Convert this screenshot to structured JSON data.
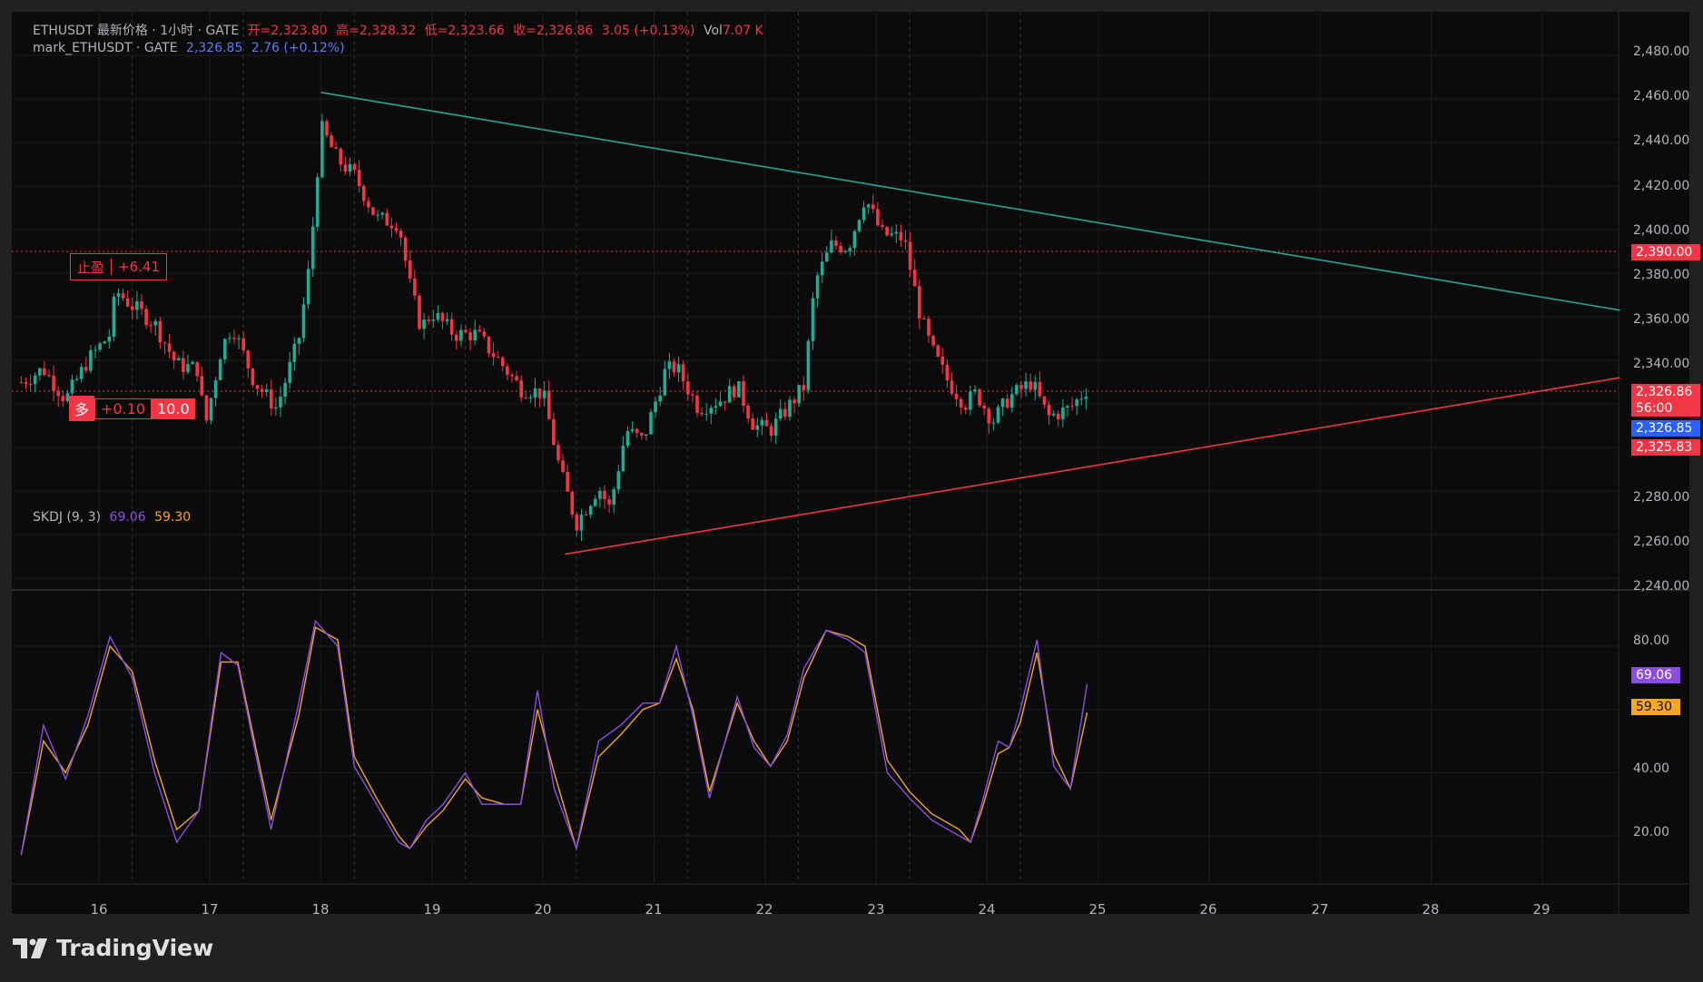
{
  "legend": {
    "symbol_line": [
      "ETHUSDT 最新价格 · 1小时 · GATE",
      "开=2,323.80",
      "高=2,328.32",
      "低=2,323.66",
      "收=2,326.86",
      "3.05 (+0.13%)",
      "Vol",
      "7.07 K"
    ],
    "mark_name": "mark_ETHUSDT · GATE",
    "mark_price": "2,326.85",
    "mark_change": "2.76 (+0.12%)"
  },
  "indicator": {
    "name": "SKDJ (9, 3)",
    "k": "69.06",
    "d": "59.30"
  },
  "price_axis": [
    "2,480.00",
    "2,460.00",
    "2,440.00",
    "2,420.00",
    "2,400.00",
    "2,380.00",
    "2,360.00",
    "2,340.00",
    "2,280.00",
    "2,260.00",
    "2,240.00"
  ],
  "indicator_axis": [
    "80.00",
    "40.00",
    "20.00"
  ],
  "price_tags": {
    "tp": "2,390.00",
    "last": "2,326.86",
    "countdown": "56:00",
    "mark": "2,326.85",
    "entry": "2,325.83",
    "k_tag": "69.06",
    "d_tag": "59.30"
  },
  "take_profit": {
    "label": "止盈",
    "value": "+6.41"
  },
  "position": {
    "side": "多",
    "pnl": "+0.10",
    "qty": "10.0"
  },
  "dates": [
    "16",
    "17",
    "18",
    "19",
    "20",
    "21",
    "22",
    "23",
    "24",
    "25",
    "26",
    "27",
    "28",
    "29"
  ],
  "brand": "TradingView",
  "colors": {
    "up": "#22ab94",
    "down": "#f23645",
    "k_line": "#8a4fe0",
    "d_line": "#f5a623",
    "trend_upper": "#26a69a",
    "trend_lower": "#f23645"
  },
  "chart_data": {
    "type": "candlestick",
    "symbol": "ETHUSDT",
    "interval": "1小时",
    "ylim": [
      2240,
      2490
    ],
    "x_dates": [
      "16",
      "17",
      "18",
      "19",
      "20",
      "21",
      "22",
      "23",
      "24",
      "25",
      "26",
      "27",
      "28",
      "29"
    ],
    "close_path": [
      [
        "15.3",
        2330
      ],
      [
        "15.5",
        2336
      ],
      [
        "15.7",
        2322
      ],
      [
        "15.9",
        2340
      ],
      [
        "16.1",
        2352
      ],
      [
        "16.15",
        2372
      ],
      [
        "16.3",
        2365
      ],
      [
        "16.5",
        2357
      ],
      [
        "16.7",
        2338
      ],
      [
        "16.9",
        2336
      ],
      [
        "16.95",
        2308
      ],
      [
        "17.1",
        2345
      ],
      [
        "17.2",
        2356
      ],
      [
        "17.4",
        2330
      ],
      [
        "17.6",
        2318
      ],
      [
        "17.8",
        2350
      ],
      [
        "17.9",
        2385
      ],
      [
        "18.0",
        2447
      ],
      [
        "18.15",
        2432
      ],
      [
        "18.3",
        2425
      ],
      [
        "18.5",
        2405
      ],
      [
        "18.7",
        2403
      ],
      [
        "18.8",
        2375
      ],
      [
        "18.9",
        2355
      ],
      [
        "19.0",
        2362
      ],
      [
        "19.2",
        2352
      ],
      [
        "19.4",
        2352
      ],
      [
        "19.6",
        2340
      ],
      [
        "19.8",
        2327
      ],
      [
        "20.0",
        2325
      ],
      [
        "20.15",
        2290
      ],
      [
        "20.3",
        2265
      ],
      [
        "20.5",
        2282
      ],
      [
        "20.6",
        2272
      ],
      [
        "20.75",
        2308
      ],
      [
        "20.9",
        2303
      ],
      [
        "21.1",
        2335
      ],
      [
        "21.2",
        2337
      ],
      [
        "21.4",
        2318
      ],
      [
        "21.6",
        2322
      ],
      [
        "21.75",
        2328
      ],
      [
        "21.9",
        2310
      ],
      [
        "22.05",
        2308
      ],
      [
        "22.2",
        2318
      ],
      [
        "22.35",
        2328
      ],
      [
        "22.45",
        2376
      ],
      [
        "22.6",
        2393
      ],
      [
        "22.75",
        2392
      ],
      [
        "22.9",
        2415
      ],
      [
        "23.05",
        2398
      ],
      [
        "23.25",
        2396
      ],
      [
        "23.4",
        2360
      ],
      [
        "23.5",
        2345
      ],
      [
        "23.65",
        2330
      ],
      [
        "23.8",
        2320
      ],
      [
        "23.9",
        2325
      ],
      [
        "24.05",
        2312
      ],
      [
        "24.2",
        2323
      ],
      [
        "24.4",
        2330
      ],
      [
        "24.55",
        2314
      ],
      [
        "24.75",
        2318
      ],
      [
        "24.9",
        2327
      ]
    ],
    "trendlines": [
      {
        "name": "upper",
        "from": [
          "18.0",
          2463
        ],
        "to": [
          "29.7",
          2363
        ]
      },
      {
        "name": "lower",
        "from": [
          "20.2",
          2251
        ],
        "to": [
          "29.7",
          2332
        ]
      }
    ],
    "horizontal_lines": [
      {
        "name": "take-profit",
        "price": 2390
      },
      {
        "name": "position",
        "price": 2325.83
      }
    ],
    "indicator": {
      "name": "SKDJ (9, 3)",
      "ylim": [
        0,
        100
      ],
      "k_path": [
        [
          "15.3",
          14
        ],
        [
          "15.5",
          55
        ],
        [
          "15.7",
          38
        ],
        [
          "15.9",
          58
        ],
        [
          "16.1",
          83
        ],
        [
          "16.3",
          70
        ],
        [
          "16.5",
          40
        ],
        [
          "16.7",
          18
        ],
        [
          "16.9",
          28
        ],
        [
          "17.1",
          78
        ],
        [
          "17.25",
          74
        ],
        [
          "17.4",
          48
        ],
        [
          "17.55",
          22
        ],
        [
          "17.8",
          62
        ],
        [
          "17.95",
          88
        ],
        [
          "18.15",
          80
        ],
        [
          "18.3",
          42
        ],
        [
          "18.5",
          30
        ],
        [
          "18.7",
          18
        ],
        [
          "18.8",
          16
        ],
        [
          "18.95",
          25
        ],
        [
          "19.1",
          30
        ],
        [
          "19.3",
          40
        ],
        [
          "19.45",
          30
        ],
        [
          "19.65",
          30
        ],
        [
          "19.8",
          30
        ],
        [
          "19.95",
          66
        ],
        [
          "20.1",
          35
        ],
        [
          "20.3",
          16
        ],
        [
          "20.5",
          50
        ],
        [
          "20.7",
          55
        ],
        [
          "20.9",
          62
        ],
        [
          "21.05",
          62
        ],
        [
          "21.2",
          80
        ],
        [
          "21.35",
          58
        ],
        [
          "21.5",
          32
        ],
        [
          "21.75",
          64
        ],
        [
          "21.9",
          48
        ],
        [
          "22.05",
          42
        ],
        [
          "22.2",
          52
        ],
        [
          "22.35",
          73
        ],
        [
          "22.55",
          85
        ],
        [
          "22.75",
          82
        ],
        [
          "22.9",
          78
        ],
        [
          "23.1",
          40
        ],
        [
          "23.3",
          32
        ],
        [
          "23.5",
          25
        ],
        [
          "23.75",
          20
        ],
        [
          "23.85",
          18
        ],
        [
          "23.95",
          30
        ],
        [
          "24.1",
          50
        ],
        [
          "24.2",
          48
        ],
        [
          "24.3",
          60
        ],
        [
          "24.45",
          82
        ],
        [
          "24.6",
          42
        ],
        [
          "24.75",
          35
        ],
        [
          "24.9",
          68
        ]
      ],
      "d_path": [
        [
          "15.3",
          14
        ],
        [
          "15.5",
          50
        ],
        [
          "15.7",
          40
        ],
        [
          "15.9",
          55
        ],
        [
          "16.1",
          80
        ],
        [
          "16.3",
          72
        ],
        [
          "16.5",
          44
        ],
        [
          "16.7",
          22
        ],
        [
          "16.9",
          28
        ],
        [
          "17.1",
          75
        ],
        [
          "17.25",
          75
        ],
        [
          "17.4",
          50
        ],
        [
          "17.55",
          25
        ],
        [
          "17.8",
          58
        ],
        [
          "17.95",
          86
        ],
        [
          "18.15",
          82
        ],
        [
          "18.3",
          45
        ],
        [
          "18.5",
          32
        ],
        [
          "18.7",
          20
        ],
        [
          "18.8",
          16
        ],
        [
          "18.95",
          23
        ],
        [
          "19.1",
          28
        ],
        [
          "19.3",
          38
        ],
        [
          "19.45",
          32
        ],
        [
          "19.65",
          30
        ],
        [
          "19.8",
          30
        ],
        [
          "19.95",
          60
        ],
        [
          "20.1",
          40
        ],
        [
          "20.3",
          16
        ],
        [
          "20.5",
          45
        ],
        [
          "20.7",
          52
        ],
        [
          "20.9",
          60
        ],
        [
          "21.05",
          62
        ],
        [
          "21.2",
          76
        ],
        [
          "21.35",
          60
        ],
        [
          "21.5",
          34
        ],
        [
          "21.75",
          62
        ],
        [
          "21.9",
          50
        ],
        [
          "22.05",
          42
        ],
        [
          "22.2",
          50
        ],
        [
          "22.35",
          70
        ],
        [
          "22.55",
          85
        ],
        [
          "22.75",
          83
        ],
        [
          "22.9",
          80
        ],
        [
          "23.1",
          44
        ],
        [
          "23.3",
          34
        ],
        [
          "23.5",
          27
        ],
        [
          "23.75",
          22
        ],
        [
          "23.85",
          18
        ],
        [
          "23.95",
          28
        ],
        [
          "24.1",
          46
        ],
        [
          "24.2",
          48
        ],
        [
          "24.3",
          56
        ],
        [
          "24.45",
          78
        ],
        [
          "24.6",
          46
        ],
        [
          "24.75",
          35
        ],
        [
          "24.9",
          59
        ]
      ]
    }
  }
}
